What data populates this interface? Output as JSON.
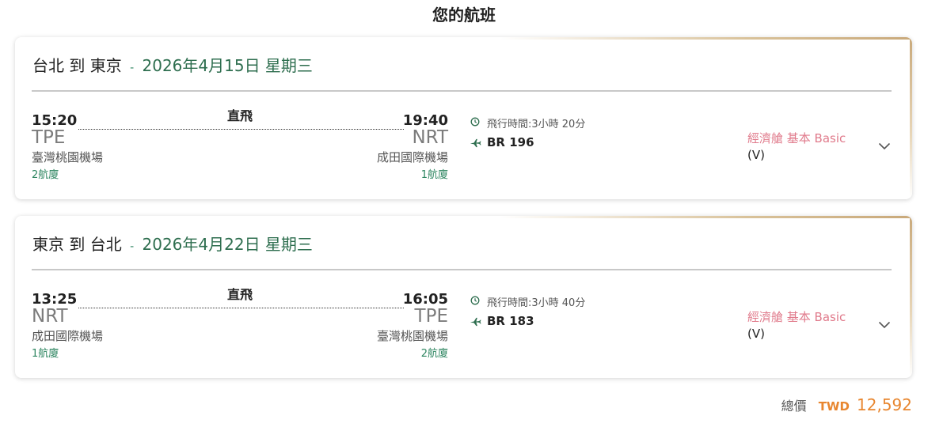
{
  "page_title": "您的航班",
  "segments": [
    {
      "route": "台北 到 東京",
      "separator": "-",
      "date": "2026年4月15日 星期三",
      "nonstop_label": "直飛",
      "departure": {
        "time": "15:20",
        "code": "TPE",
        "airport": "臺灣桃園機場",
        "terminal": "2航廈"
      },
      "arrival": {
        "time": "19:40",
        "code": "NRT",
        "airport": "成田國際機場",
        "terminal": "1航廈"
      },
      "duration": "飛行時間:3小時 20分",
      "flight_number": "BR 196",
      "fare_class": "經濟艙 基本 Basic",
      "fare_code": "(V)"
    },
    {
      "route": "東京 到 台北",
      "separator": "-",
      "date": "2026年4月22日 星期三",
      "nonstop_label": "直飛",
      "departure": {
        "time": "13:25",
        "code": "NRT",
        "airport": "成田國際機場",
        "terminal": "1航廈"
      },
      "arrival": {
        "time": "16:05",
        "code": "TPE",
        "airport": "臺灣桃園機場",
        "terminal": "2航廈"
      },
      "duration": "飛行時間:3小時 40分",
      "flight_number": "BR 183",
      "fare_class": "經濟艙 基本 Basic",
      "fare_code": "(V)"
    }
  ],
  "total": {
    "label": "總價",
    "currency": "TWD",
    "amount": "12,592"
  },
  "icons": {
    "duration": "clock-icon",
    "flight": "airplane-icon",
    "expand": "chevron-down-icon"
  },
  "colors": {
    "accent_green": "#2e6e4f",
    "fare_pink": "#e07a8b",
    "price_orange": "#e8862f",
    "card_gold": "#c9a97a"
  }
}
